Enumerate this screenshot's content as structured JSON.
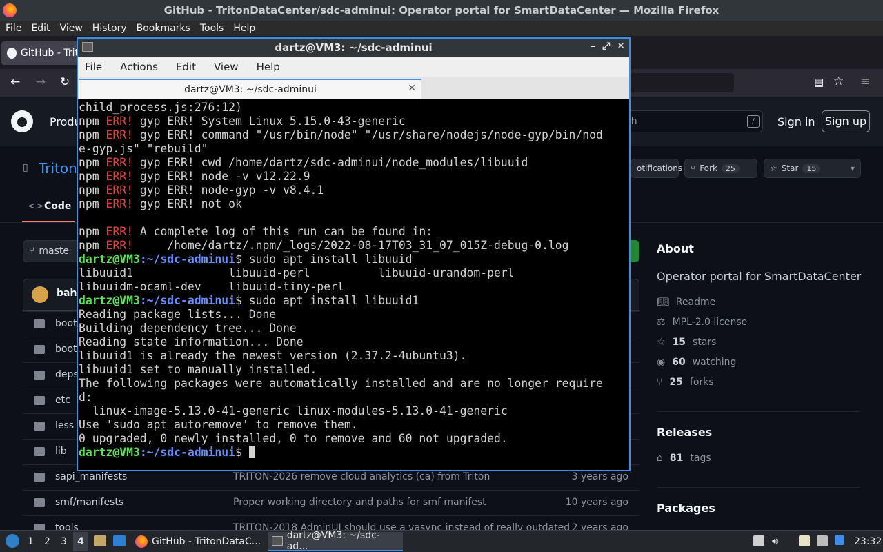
{
  "firefox": {
    "window_title": "GitHub - TritonDataCenter/sdc-adminui: Operator portal for SmartDataCenter — Mozilla Firefox",
    "menu": [
      {
        "label": "File"
      },
      {
        "label": "Edit"
      },
      {
        "label": "View"
      },
      {
        "label": "History"
      },
      {
        "label": "Bookmarks"
      },
      {
        "label": "Tools"
      },
      {
        "label": "Help"
      }
    ],
    "tab_label": "GitHub - TritonDataCenter/sdc-adminui",
    "tab_label_visible": "GitHub - Trit"
  },
  "github": {
    "nav_product": "Produ",
    "search_placeholder": "ch",
    "search_shortcut": "/",
    "sign_in": "Sign in",
    "sign_up": "Sign up",
    "repo_name_visible": "Triton",
    "notifications_label": "otifications",
    "fork_label": "Fork",
    "fork_count": "25",
    "star_label": "Star",
    "star_count": "15",
    "code_tab": "Code",
    "branch_visible": "maste",
    "commit_author_visible": "baha",
    "files": [
      {
        "name": "boot",
        "msg": "",
        "age": ""
      },
      {
        "name": "boots",
        "msg": "",
        "age": ""
      },
      {
        "name": "deps",
        "msg": "",
        "age": ""
      },
      {
        "name": "etc",
        "msg": "",
        "age": ""
      },
      {
        "name": "less",
        "msg": "",
        "age": ""
      },
      {
        "name": "lib",
        "msg": "",
        "age": ""
      },
      {
        "name": "sapi_manifests",
        "msg": "TRITON-2026 remove cloud analytics (ca) from Triton",
        "age": "3 years ago"
      },
      {
        "name": "smf/manifests",
        "msg": "Proper working directory and paths for smf manifest",
        "age": "10 years ago"
      },
      {
        "name": "tools",
        "msg": "TRITON-2018 AdminUI should use a vasync instead of really outdated",
        "age": "2 years ago"
      }
    ],
    "about": {
      "title": "About",
      "description": "Operator portal for SmartDataCenter",
      "readme": "Readme",
      "license": "MPL-2.0 license",
      "stars_count": "15",
      "stars_label": "stars",
      "watching_count": "60",
      "watching_label": "watching",
      "forks_count": "25",
      "forks_label": "forks",
      "releases_title": "Releases",
      "tags_count": "81",
      "tags_label": "tags",
      "packages_title": "Packages"
    }
  },
  "terminal": {
    "window_title": "dartz@VM3: ~/sdc-adminui",
    "menu": [
      {
        "label": "File"
      },
      {
        "label": "Actions"
      },
      {
        "label": "Edit"
      },
      {
        "label": "View"
      },
      {
        "label": "Help"
      }
    ],
    "tab_title": "dartz@VM3: ~/sdc-adminui",
    "lines": [
      {
        "kind": "plain",
        "text": "child_process.js:276:12)"
      },
      {
        "kind": "err",
        "a": "npm ",
        "b": "ERR!",
        "c": " gyp ERR! System Linux 5.15.0-43-generic"
      },
      {
        "kind": "err",
        "a": "npm ",
        "b": "ERR!",
        "c": " gyp ERR! command \"/usr/bin/node\" \"/usr/share/nodejs/node-gyp/bin/nod"
      },
      {
        "kind": "plain",
        "text": "e-gyp.js\" \"rebuild\""
      },
      {
        "kind": "err",
        "a": "npm ",
        "b": "ERR!",
        "c": " gyp ERR! cwd /home/dartz/sdc-adminui/node_modules/libuuid"
      },
      {
        "kind": "err",
        "a": "npm ",
        "b": "ERR!",
        "c": " gyp ERR! node -v v12.22.9"
      },
      {
        "kind": "err",
        "a": "npm ",
        "b": "ERR!",
        "c": " gyp ERR! node-gyp -v v8.4.1"
      },
      {
        "kind": "err",
        "a": "npm ",
        "b": "ERR!",
        "c": " gyp ERR! not ok"
      },
      {
        "kind": "plain",
        "text": ""
      },
      {
        "kind": "err",
        "a": "npm ",
        "b": "ERR!",
        "c": " A complete log of this run can be found in:"
      },
      {
        "kind": "err",
        "a": "npm ",
        "b": "ERR!",
        "c": "     /home/dartz/.npm/_logs/2022-08-17T03_31_07_015Z-debug-0.log"
      },
      {
        "kind": "prompt",
        "user": "dartz@VM3",
        "path": ":~/sdc-adminui",
        "cmd": "$ sudo apt install libuuid"
      },
      {
        "kind": "plain",
        "text": "libuuid1              libuuid-perl          libuuid-urandom-perl"
      },
      {
        "kind": "plain",
        "text": "libuuidm-ocaml-dev    libuuid-tiny-perl"
      },
      {
        "kind": "prompt",
        "user": "dartz@VM3",
        "path": ":~/sdc-adminui",
        "cmd": "$ sudo apt install libuuid1"
      },
      {
        "kind": "plain",
        "text": "Reading package lists... Done"
      },
      {
        "kind": "plain",
        "text": "Building dependency tree... Done"
      },
      {
        "kind": "plain",
        "text": "Reading state information... Done"
      },
      {
        "kind": "plain",
        "text": "libuuid1 is already the newest version (2.37.2-4ubuntu3)."
      },
      {
        "kind": "plain",
        "text": "libuuid1 set to manually installed."
      },
      {
        "kind": "plain",
        "text": "The following packages were automatically installed and are no longer require"
      },
      {
        "kind": "plain",
        "text": "d:"
      },
      {
        "kind": "plain",
        "text": "  linux-image-5.13.0-41-generic linux-modules-5.13.0-41-generic"
      },
      {
        "kind": "plain",
        "text": "Use 'sudo apt autoremove' to remove them."
      },
      {
        "kind": "plain",
        "text": "0 upgraded, 0 newly installed, 0 to remove and 60 not upgraded."
      },
      {
        "kind": "prompt",
        "user": "dartz@VM3",
        "path": ":~/sdc-adminui",
        "cmd": "$ ",
        "cursor": true
      }
    ]
  },
  "taskbar": {
    "workspaces": [
      "1",
      "2",
      "3",
      "4"
    ],
    "active_workspace": "4",
    "tasks": [
      {
        "label": "GitHub - TritonDataC..."
      },
      {
        "label": "dartz@VM3: ~/sdc-ad..."
      }
    ],
    "clock": "23:32"
  },
  "colors": {
    "terminal_accent": "#3d8ee6",
    "err": "#e44040",
    "prompt_user": "#5ee05e",
    "prompt_path": "#6b8fff",
    "github_bg": "#0d1117"
  }
}
